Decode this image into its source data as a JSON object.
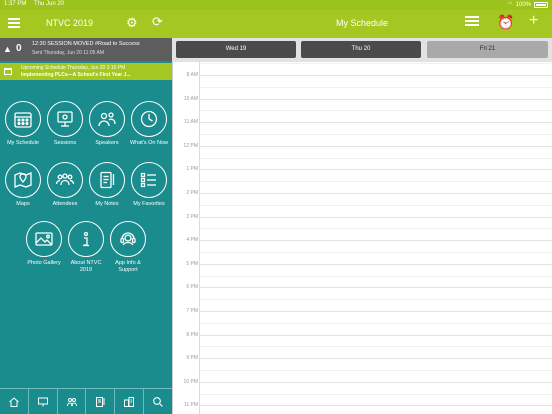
{
  "status_bar": {
    "time": "1:37 PM",
    "date": "Thu Jun 20",
    "battery": "100%"
  },
  "app_bar": {
    "title": "NTVC 2019",
    "page_title": "My Schedule"
  },
  "notice": {
    "count": "0",
    "title": "12:30 SESSION MOVED #Road to Success",
    "sent": "Sent Thursday, Jun 20 11:05 AM"
  },
  "upcoming": {
    "line1": "Upcoming Schedule Thursday, Jun 20 2:10 PM",
    "line2": "Implementing PLCs—A School's First Year J..."
  },
  "menu": {
    "my_schedule": "My Schedule",
    "sessions": "Sessions",
    "speakers": "Speakers",
    "whats_on": "What's On Now",
    "maps": "Maps",
    "attendees": "Attendees",
    "my_notes": "My Notes",
    "my_favorites": "My Favorites",
    "photo_gallery": "Photo Gallery",
    "about": "About NTVC 2019",
    "app_info": "App Info & Support"
  },
  "days": [
    "Wed 19",
    "Thu 20",
    "Fri 21"
  ],
  "selected_day": 2,
  "hours": [
    "8 AM",
    "10 AM",
    "11 AM",
    "12 PM",
    "1 PM",
    "2 PM",
    "3 PM",
    "4 PM",
    "5 PM",
    "6 PM",
    "7 PM",
    "8 PM",
    "9 PM",
    "10 PM",
    "11 PM"
  ],
  "colors": {
    "accent": "#a4c821",
    "sidebar": "#1b8c8d",
    "notice": "#5d5d5d"
  }
}
